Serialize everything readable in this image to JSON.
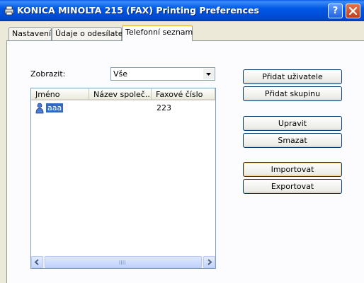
{
  "window": {
    "title": "KONICA MINOLTA 215 (FAX) Printing Preferences",
    "help_label": "?",
    "close_label": "✕"
  },
  "tabs": [
    {
      "label": "Nastavení"
    },
    {
      "label": "Údaje o odesílateli"
    },
    {
      "label": "Telefonní seznam"
    }
  ],
  "display": {
    "label": "Zobrazit:",
    "value": "Vše"
  },
  "list": {
    "columns": [
      "Jméno",
      "Název společ...",
      "Faxové číslo"
    ],
    "rows": [
      {
        "name": "aaa",
        "company": "",
        "fax": "223"
      }
    ]
  },
  "buttons": {
    "add_user": "Přidat uživatele",
    "add_group": "Přidat skupinu",
    "edit": "Upravit",
    "delete": "Smazat",
    "import": "Importovat",
    "export": "Exportovat"
  },
  "colors": {
    "titlebar": "#0058e6",
    "selection": "#316ac5",
    "dialog_bg": "#ece9d8"
  }
}
